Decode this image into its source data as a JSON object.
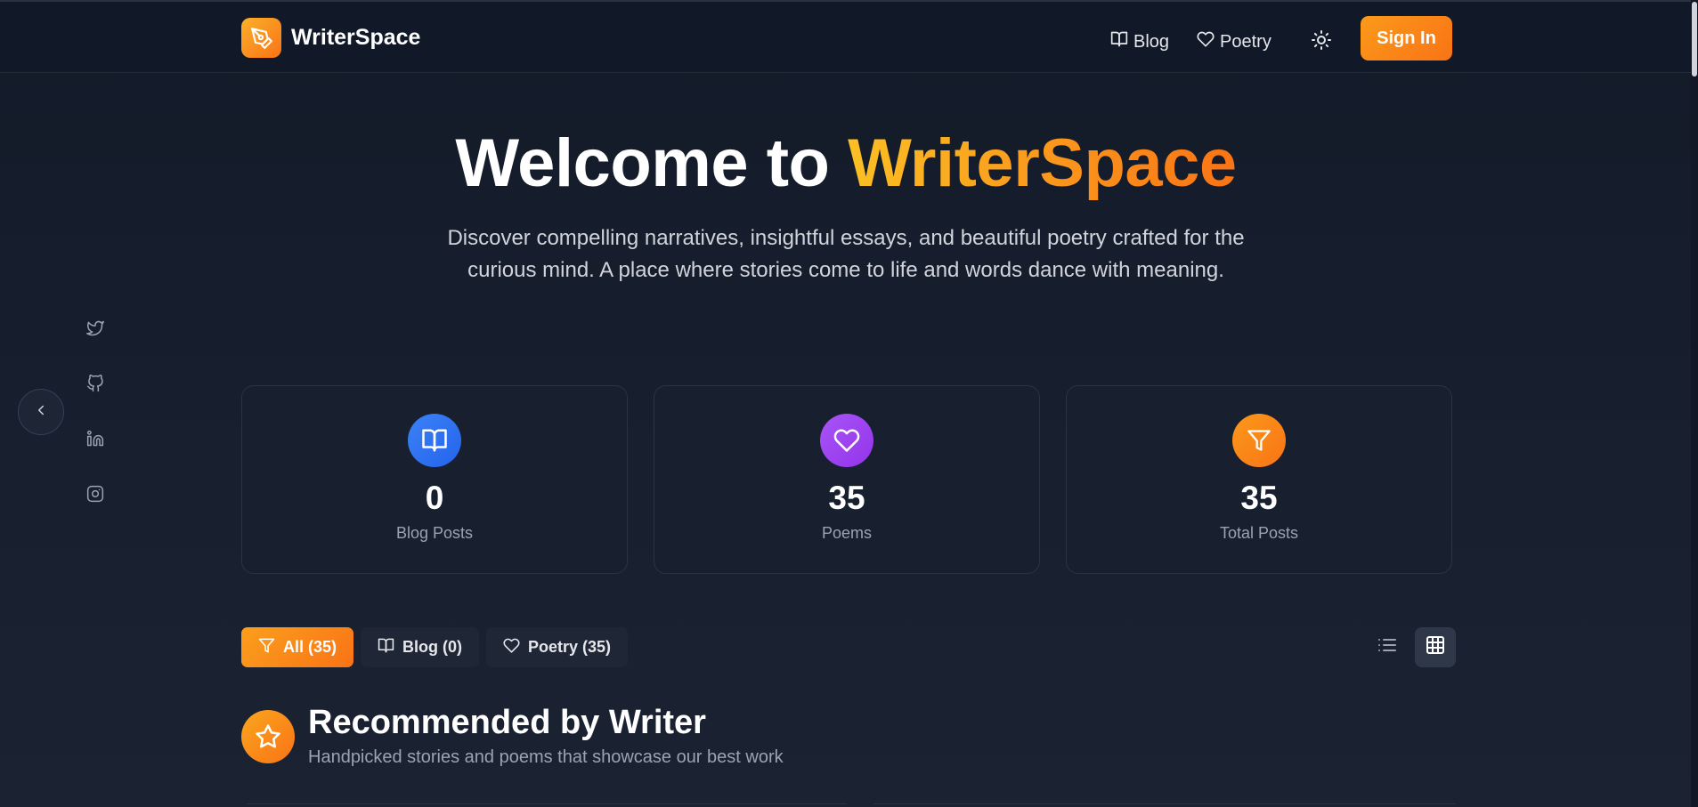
{
  "header": {
    "brand": "WriterSpace",
    "nav": [
      {
        "label": "Blog",
        "icon": "book-icon"
      },
      {
        "label": "Poetry",
        "icon": "heart-icon"
      }
    ],
    "theme_icon": "sun-icon",
    "sign_in_label": "Sign In"
  },
  "hero": {
    "title_prefix": "Welcome to ",
    "title_accent": "WriterSpace",
    "subtitle": "Discover compelling narratives, insightful essays, and beautiful poetry crafted for the curious mind. A place where stories come to life and words dance with meaning."
  },
  "socials": [
    "twitter-icon",
    "github-icon",
    "linkedin-icon",
    "instagram-icon"
  ],
  "stats": [
    {
      "value": "0",
      "label": "Blog Posts",
      "icon": "book-open-icon",
      "color": "#3b82f6"
    },
    {
      "value": "35",
      "label": "Poems",
      "icon": "heart-icon",
      "color": "#a855f7"
    },
    {
      "value": "35",
      "label": "Total Posts",
      "icon": "filter-icon",
      "color": "#f97316"
    }
  ],
  "filters": [
    {
      "label": "All (35)",
      "icon": "filter-icon",
      "active": true
    },
    {
      "label": "Blog (0)",
      "icon": "book-icon",
      "active": false
    },
    {
      "label": "Poetry (35)",
      "icon": "heart-icon",
      "active": false
    }
  ],
  "view_modes": [
    {
      "icon": "list-icon",
      "active": false
    },
    {
      "icon": "grid-icon",
      "active": true
    }
  ],
  "section": {
    "title": "Recommended by Writer",
    "subtitle": "Handpicked stories and poems that showcase our best work",
    "icon": "star-icon"
  },
  "colors": {
    "accent": "#f97316",
    "accent_light": "#fbbf24",
    "background": "#151b29",
    "header": "#111827"
  }
}
